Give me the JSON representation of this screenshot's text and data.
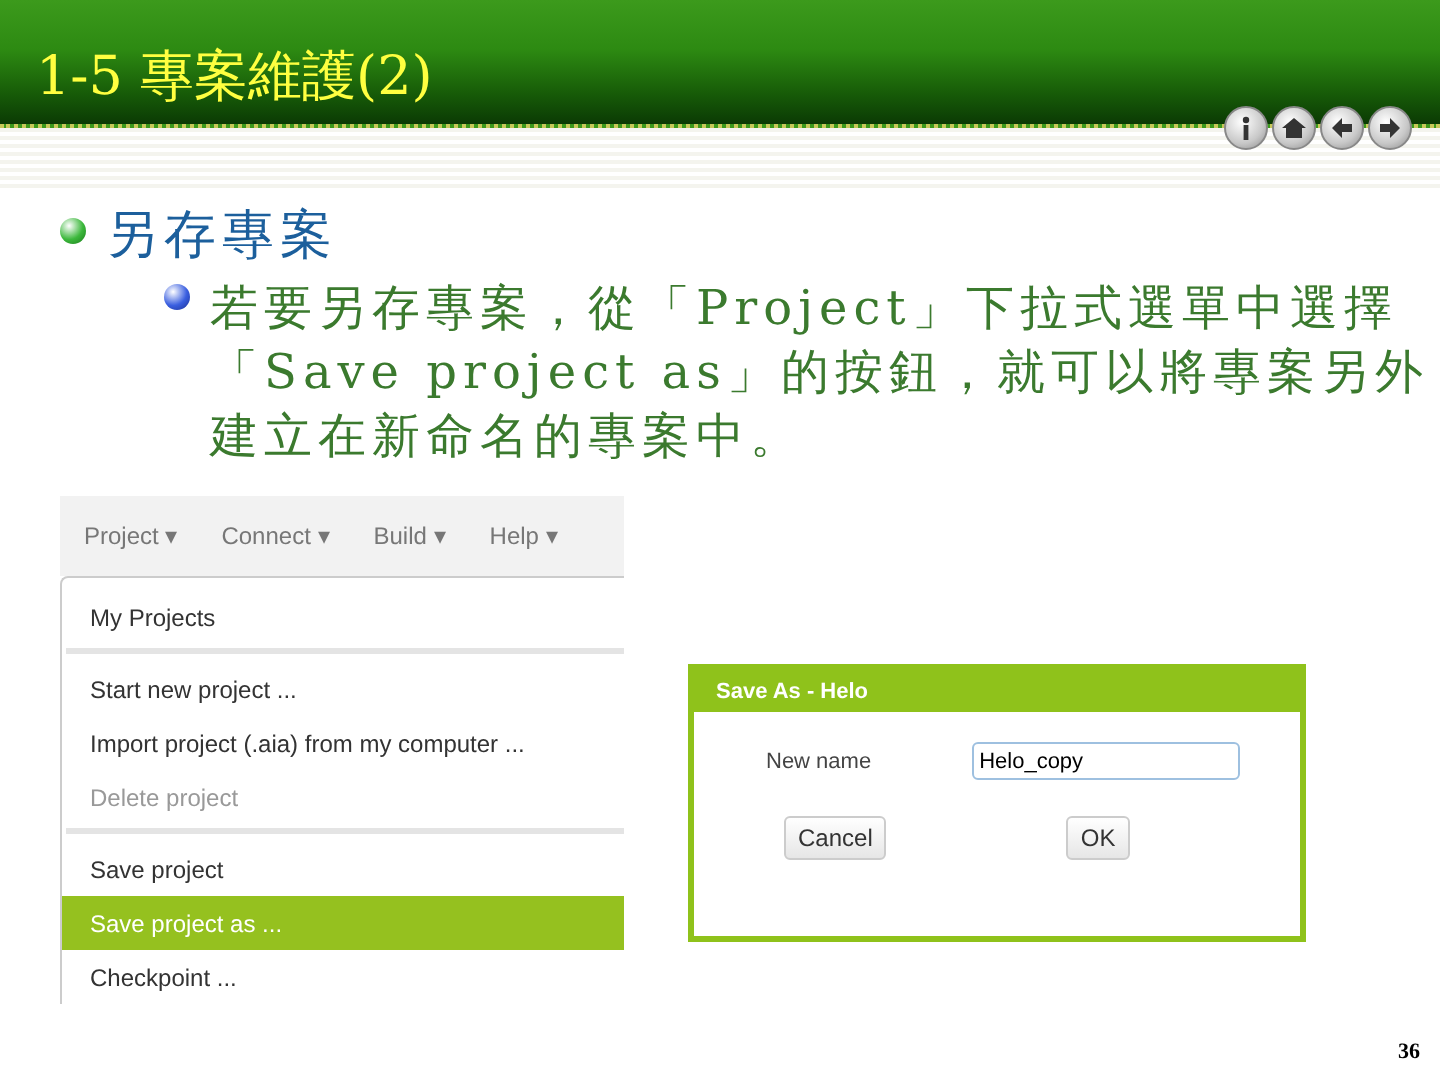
{
  "slide": {
    "title": "1-5 專案維護(2)",
    "nav_buttons": [
      {
        "kind": "info"
      },
      {
        "kind": "home"
      },
      {
        "kind": "back"
      },
      {
        "kind": "forward"
      }
    ],
    "page_number": "36"
  },
  "bullets": [
    {
      "text": "另存專案",
      "children": [
        {
          "text": "若要另存專案，從「Project」下拉式選單中選擇「Save project as」的按鈕，就可以將專案另外建立在新命名的專案中。"
        }
      ]
    }
  ],
  "menu_screenshot": {
    "menu_bar": [
      {
        "label": "Project",
        "caret": "▾"
      },
      {
        "label": "Connect",
        "caret": "▾"
      },
      {
        "label": "Build",
        "caret": "▾"
      },
      {
        "label": "Help",
        "caret": "▾"
      }
    ],
    "items": [
      {
        "label": "My Projects",
        "disabled": false,
        "selected": false,
        "divider_after": true
      },
      {
        "label": "Start new project ...",
        "disabled": false,
        "selected": false,
        "divider_after": false
      },
      {
        "label": "Import project (.aia) from my computer ...",
        "disabled": false,
        "selected": false,
        "divider_after": false
      },
      {
        "label": "Delete project",
        "disabled": true,
        "selected": false,
        "divider_after": true
      },
      {
        "label": "Save project",
        "disabled": false,
        "selected": false,
        "divider_after": false
      },
      {
        "label": "Save project as ...",
        "disabled": false,
        "selected": true,
        "divider_after": false
      },
      {
        "label": "Checkpoint ...",
        "disabled": false,
        "selected": false,
        "divider_after": false
      }
    ]
  },
  "dialog": {
    "title": "Save As - Helo",
    "field_label": "New name",
    "field_value": "Helo_copy",
    "buttons": [
      "Cancel",
      "OK"
    ]
  }
}
